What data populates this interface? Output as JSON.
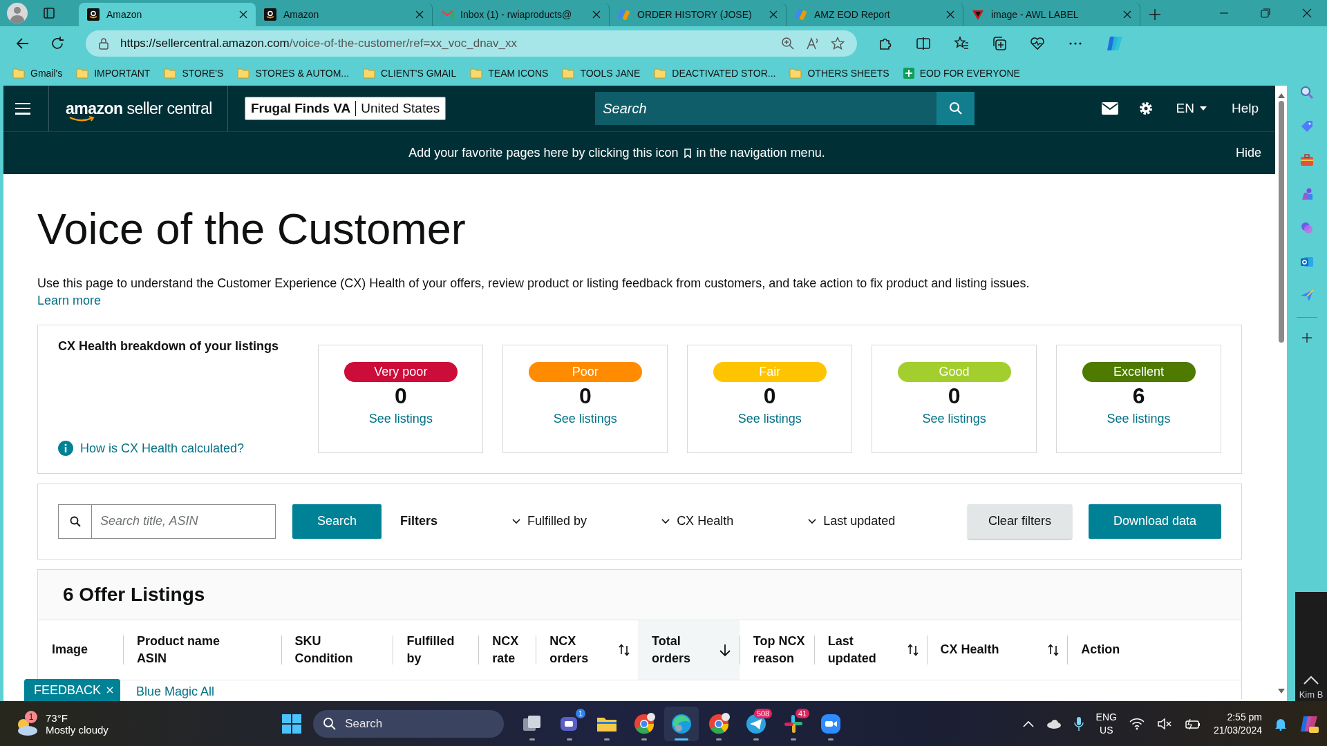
{
  "browser": {
    "tabs": [
      {
        "title": "Amazon",
        "kind": "amazon",
        "selected": true
      },
      {
        "title": "Amazon",
        "kind": "amazon",
        "selected": false
      },
      {
        "title": "Inbox (1) - rwiaproducts@",
        "kind": "mail",
        "selected": false
      },
      {
        "title": "ORDER HISTORY (JOSE)",
        "kind": "app",
        "selected": false
      },
      {
        "title": "AMZ EOD Report",
        "kind": "app",
        "selected": false
      },
      {
        "title": "image - AWL LABEL",
        "kind": "label",
        "selected": false
      }
    ],
    "url_host": "https://sellercentral.amazon.com",
    "url_path": "/voice-of-the-customer/ref=xx_voc_dnav_xx",
    "bookmarks": [
      {
        "label": "Gmail's",
        "kind": "folder"
      },
      {
        "label": "IMPORTANT",
        "kind": "folder"
      },
      {
        "label": "STORE'S",
        "kind": "folder"
      },
      {
        "label": "STORES & AUTOM...",
        "kind": "folder"
      },
      {
        "label": "CLIENT'S GMAIL",
        "kind": "folder"
      },
      {
        "label": "TEAM ICONS",
        "kind": "folder"
      },
      {
        "label": "TOOLS JANE",
        "kind": "folder"
      },
      {
        "label": "DEACTIVATED STOR...",
        "kind": "folder"
      },
      {
        "label": "OTHERS SHEETS",
        "kind": "folder"
      },
      {
        "label": "EOD FOR EVERYONE",
        "kind": "sheet"
      }
    ]
  },
  "header": {
    "logo": "**amazon** seller central",
    "store": "Frugal Finds VA",
    "marketplace": "United States",
    "search_placeholder": "Search",
    "language": "EN",
    "help": "Help"
  },
  "banner": {
    "text_before": "Add your favorite pages here by clicking this icon",
    "text_after": "in the navigation menu.",
    "hide": "Hide"
  },
  "page": {
    "title": "Voice of the Customer",
    "description": "Use this page to understand the Customer Experience (CX) Health of your offers, review product or listing feedback from customers, and take action to fix product and listing issues.",
    "learn_more": "Learn more"
  },
  "cx_health": {
    "heading": "CX Health breakdown of your listings",
    "info_link": "How is CX Health calculated?",
    "buckets": [
      {
        "label": "Very poor",
        "color": "#cc0c39",
        "count": "0",
        "link": "See listings"
      },
      {
        "label": "Poor",
        "color": "#ff8c00",
        "count": "0",
        "link": "See listings"
      },
      {
        "label": "Fair",
        "color": "#ffc400",
        "count": "0",
        "link": "See listings"
      },
      {
        "label": "Good",
        "color": "#a3cf2e",
        "count": "0",
        "link": "See listings"
      },
      {
        "label": "Excellent",
        "color": "#4e7a00",
        "count": "6",
        "link": "See listings"
      }
    ]
  },
  "filters": {
    "search_placeholder": "Search title, ASIN",
    "search_button": "Search",
    "title": "Filters",
    "dropdowns": [
      "Fulfilled by",
      "CX Health",
      "Last updated"
    ],
    "clear": "Clear filters",
    "download": "Download data"
  },
  "listings": {
    "title": "6 Offer Listings",
    "columns": [
      {
        "lines": [
          "Image"
        ],
        "kind": "plain"
      },
      {
        "lines": [
          "Product name",
          "ASIN"
        ],
        "kind": "plain"
      },
      {
        "lines": [
          "SKU",
          "Condition"
        ],
        "kind": "plain"
      },
      {
        "lines": [
          "Fulfilled",
          "by"
        ],
        "kind": "plain"
      },
      {
        "lines": [
          "NCX",
          "rate"
        ],
        "kind": "plain"
      },
      {
        "lines": [
          "NCX",
          "orders"
        ],
        "kind": "sortable"
      },
      {
        "lines": [
          "Total",
          "orders"
        ],
        "kind": "sorted-desc"
      },
      {
        "lines": [
          "Top NCX",
          "reason"
        ],
        "kind": "plain"
      },
      {
        "lines": [
          "Last",
          "updated"
        ],
        "kind": "sortable"
      },
      {
        "lines": [
          "CX Health"
        ],
        "kind": "sortable"
      },
      {
        "lines": [
          "Action"
        ],
        "kind": "plain"
      }
    ],
    "first_row_product": "Blue Magic All"
  },
  "feedback": "FEEDBACK",
  "video_overlay_text": "Kim B",
  "taskbar": {
    "weather_temp": "73°F",
    "weather_text": "Mostly cloudy",
    "weather_badge": "1",
    "search_placeholder": "Search",
    "apps": [
      {
        "kind": "taskview",
        "active": false
      },
      {
        "kind": "chat",
        "badge": "1",
        "active": false
      },
      {
        "kind": "folder",
        "active": false
      },
      {
        "kind": "chrome",
        "active": false
      },
      {
        "kind": "edge",
        "active": true
      },
      {
        "kind": "chrome",
        "active": false
      },
      {
        "kind": "telegram",
        "badge": "508",
        "active": false
      },
      {
        "kind": "slack",
        "badge": "41",
        "active": false
      },
      {
        "kind": "zoom",
        "active": false
      }
    ],
    "lang_top": "ENG",
    "lang_bottom": "US",
    "time": "2:55 pm",
    "date": "21/03/2024"
  }
}
